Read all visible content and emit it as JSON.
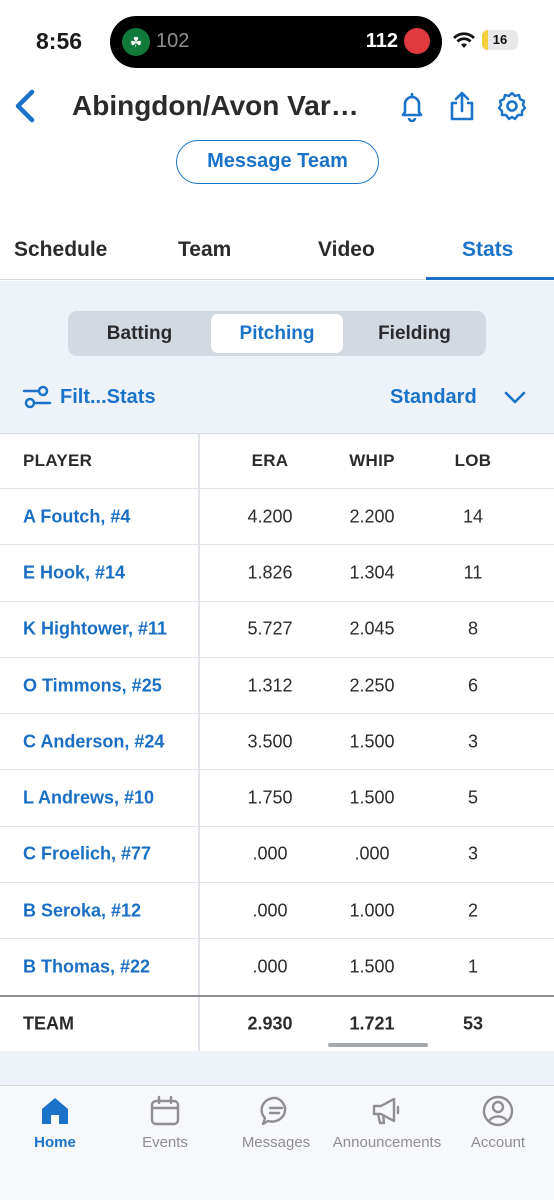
{
  "status": {
    "time": "8:56",
    "score_left": "102",
    "score_right": "112",
    "battery": "16",
    "battery_fraction": 0.16
  },
  "header": {
    "title": "Abingdon/Avon Var…",
    "message_button": "Message Team"
  },
  "tabs": [
    "Schedule",
    "Team",
    "Video",
    "Stats"
  ],
  "active_tab": "Stats",
  "segments": [
    "Batting",
    "Pitching",
    "Fielding"
  ],
  "active_segment": "Pitching",
  "filter_label": "Filt...Stats",
  "view_select": "Standard",
  "table": {
    "columns": [
      "PLAYER",
      "ERA",
      "WHIP",
      "LOB"
    ],
    "rows": [
      {
        "player": "A Foutch, #4",
        "era": "4.200",
        "whip": "2.200",
        "lob": "14"
      },
      {
        "player": "E Hook, #14",
        "era": "1.826",
        "whip": "1.304",
        "lob": "11"
      },
      {
        "player": "K Hightower, #11",
        "era": "5.727",
        "whip": "2.045",
        "lob": "8"
      },
      {
        "player": "O Timmons, #25",
        "era": "1.312",
        "whip": "2.250",
        "lob": "6"
      },
      {
        "player": "C Anderson, #24",
        "era": "3.500",
        "whip": "1.500",
        "lob": "3"
      },
      {
        "player": "L Andrews, #10",
        "era": "1.750",
        "whip": "1.500",
        "lob": "5"
      },
      {
        "player": "C Froelich, #77",
        "era": ".000",
        "whip": ".000",
        "lob": "3"
      },
      {
        "player": "B Seroka, #12",
        "era": ".000",
        "whip": "1.000",
        "lob": "2"
      },
      {
        "player": "B Thomas, #22",
        "era": ".000",
        "whip": "1.500",
        "lob": "1"
      }
    ],
    "team": {
      "player": "TEAM",
      "era": "2.930",
      "whip": "1.721",
      "lob": "53"
    }
  },
  "bottom_nav": {
    "items": [
      "Home",
      "Events",
      "Messages",
      "Announcements",
      "Account"
    ],
    "icons": [
      "home-icon",
      "calendar-icon",
      "chat-bubble-icon",
      "megaphone-icon",
      "account-icon"
    ],
    "active": "Home"
  },
  "colors": {
    "accent": "#1a73c9",
    "surface": "#eef3fa"
  }
}
